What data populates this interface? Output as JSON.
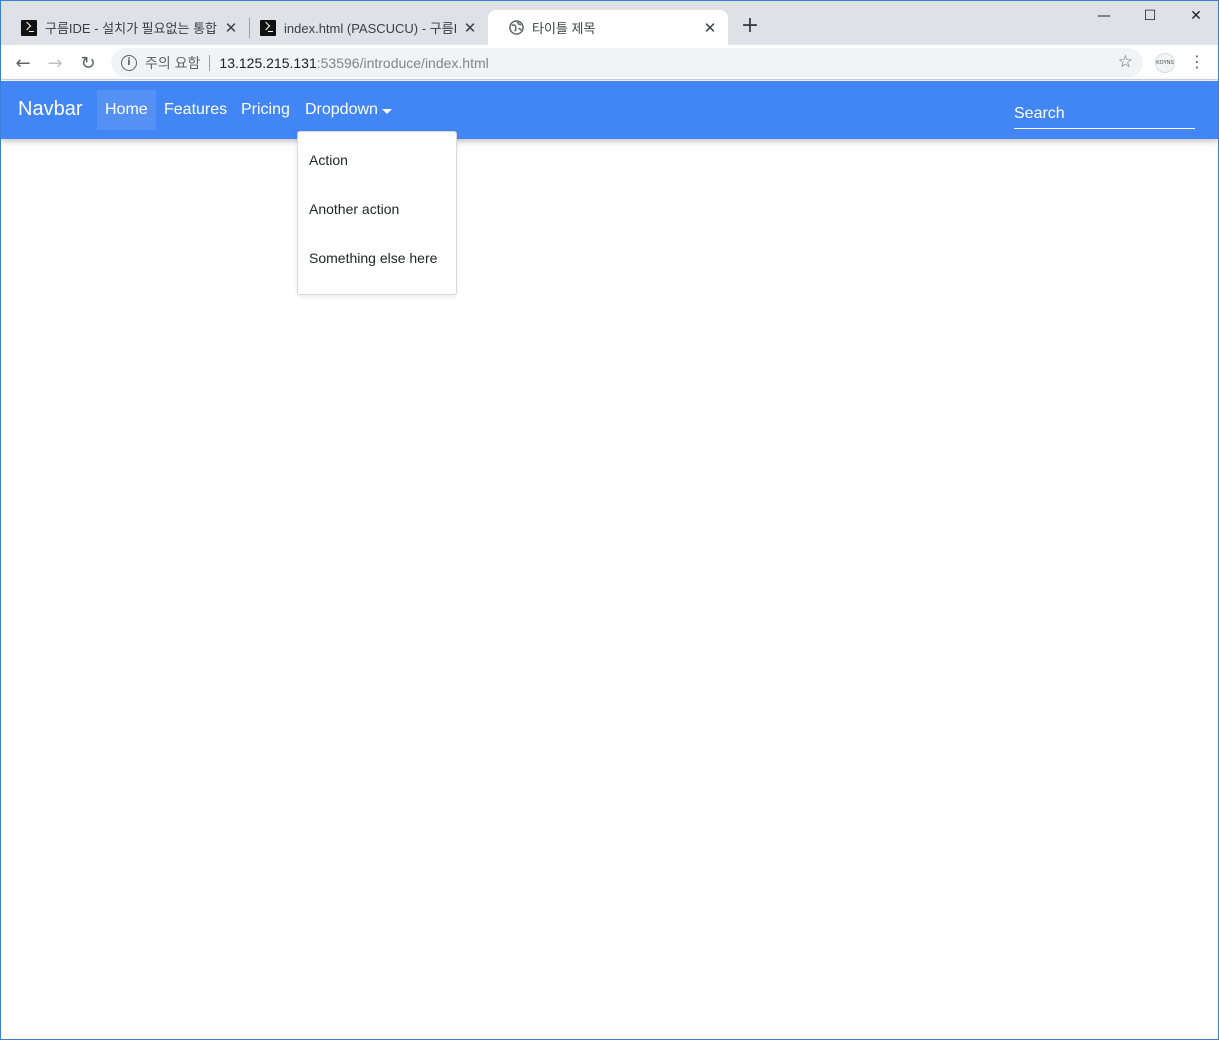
{
  "browser": {
    "tabs": [
      {
        "title": "구름IDE - 설치가 필요없는 통합",
        "icon": "terminal-icon",
        "active": false
      },
      {
        "title": "index.html (PASCUCU) - 구름IDE",
        "icon": "terminal-icon",
        "active": false
      },
      {
        "title": "타이틀 제목",
        "icon": "globe-icon",
        "active": true
      }
    ],
    "close_glyph": "✕",
    "new_tab_glyph": "+",
    "window_controls": {
      "minimize": "—",
      "maximize": "☐",
      "close": "✕"
    },
    "back_glyph": "←",
    "forward_glyph": "→",
    "reload_glyph": "↻",
    "info_glyph": "i",
    "security_label": "주의 요함",
    "url_host": "13.125.215.131",
    "url_rest": ":53596/introduce/index.html",
    "star_glyph": "☆",
    "extension_label": "KOYNS",
    "menu_glyph": "⋮"
  },
  "page": {
    "navbar": {
      "brand": "Navbar",
      "background_color": "#4285f4",
      "items": [
        {
          "label": "Home",
          "active": true
        },
        {
          "label": "Features",
          "active": false
        },
        {
          "label": "Pricing",
          "active": false
        },
        {
          "label": "Dropdown",
          "active": false,
          "has_caret": true
        }
      ],
      "search_placeholder": "Search"
    },
    "dropdown": {
      "items": [
        "Action",
        "Another action",
        "Something else here"
      ]
    }
  }
}
